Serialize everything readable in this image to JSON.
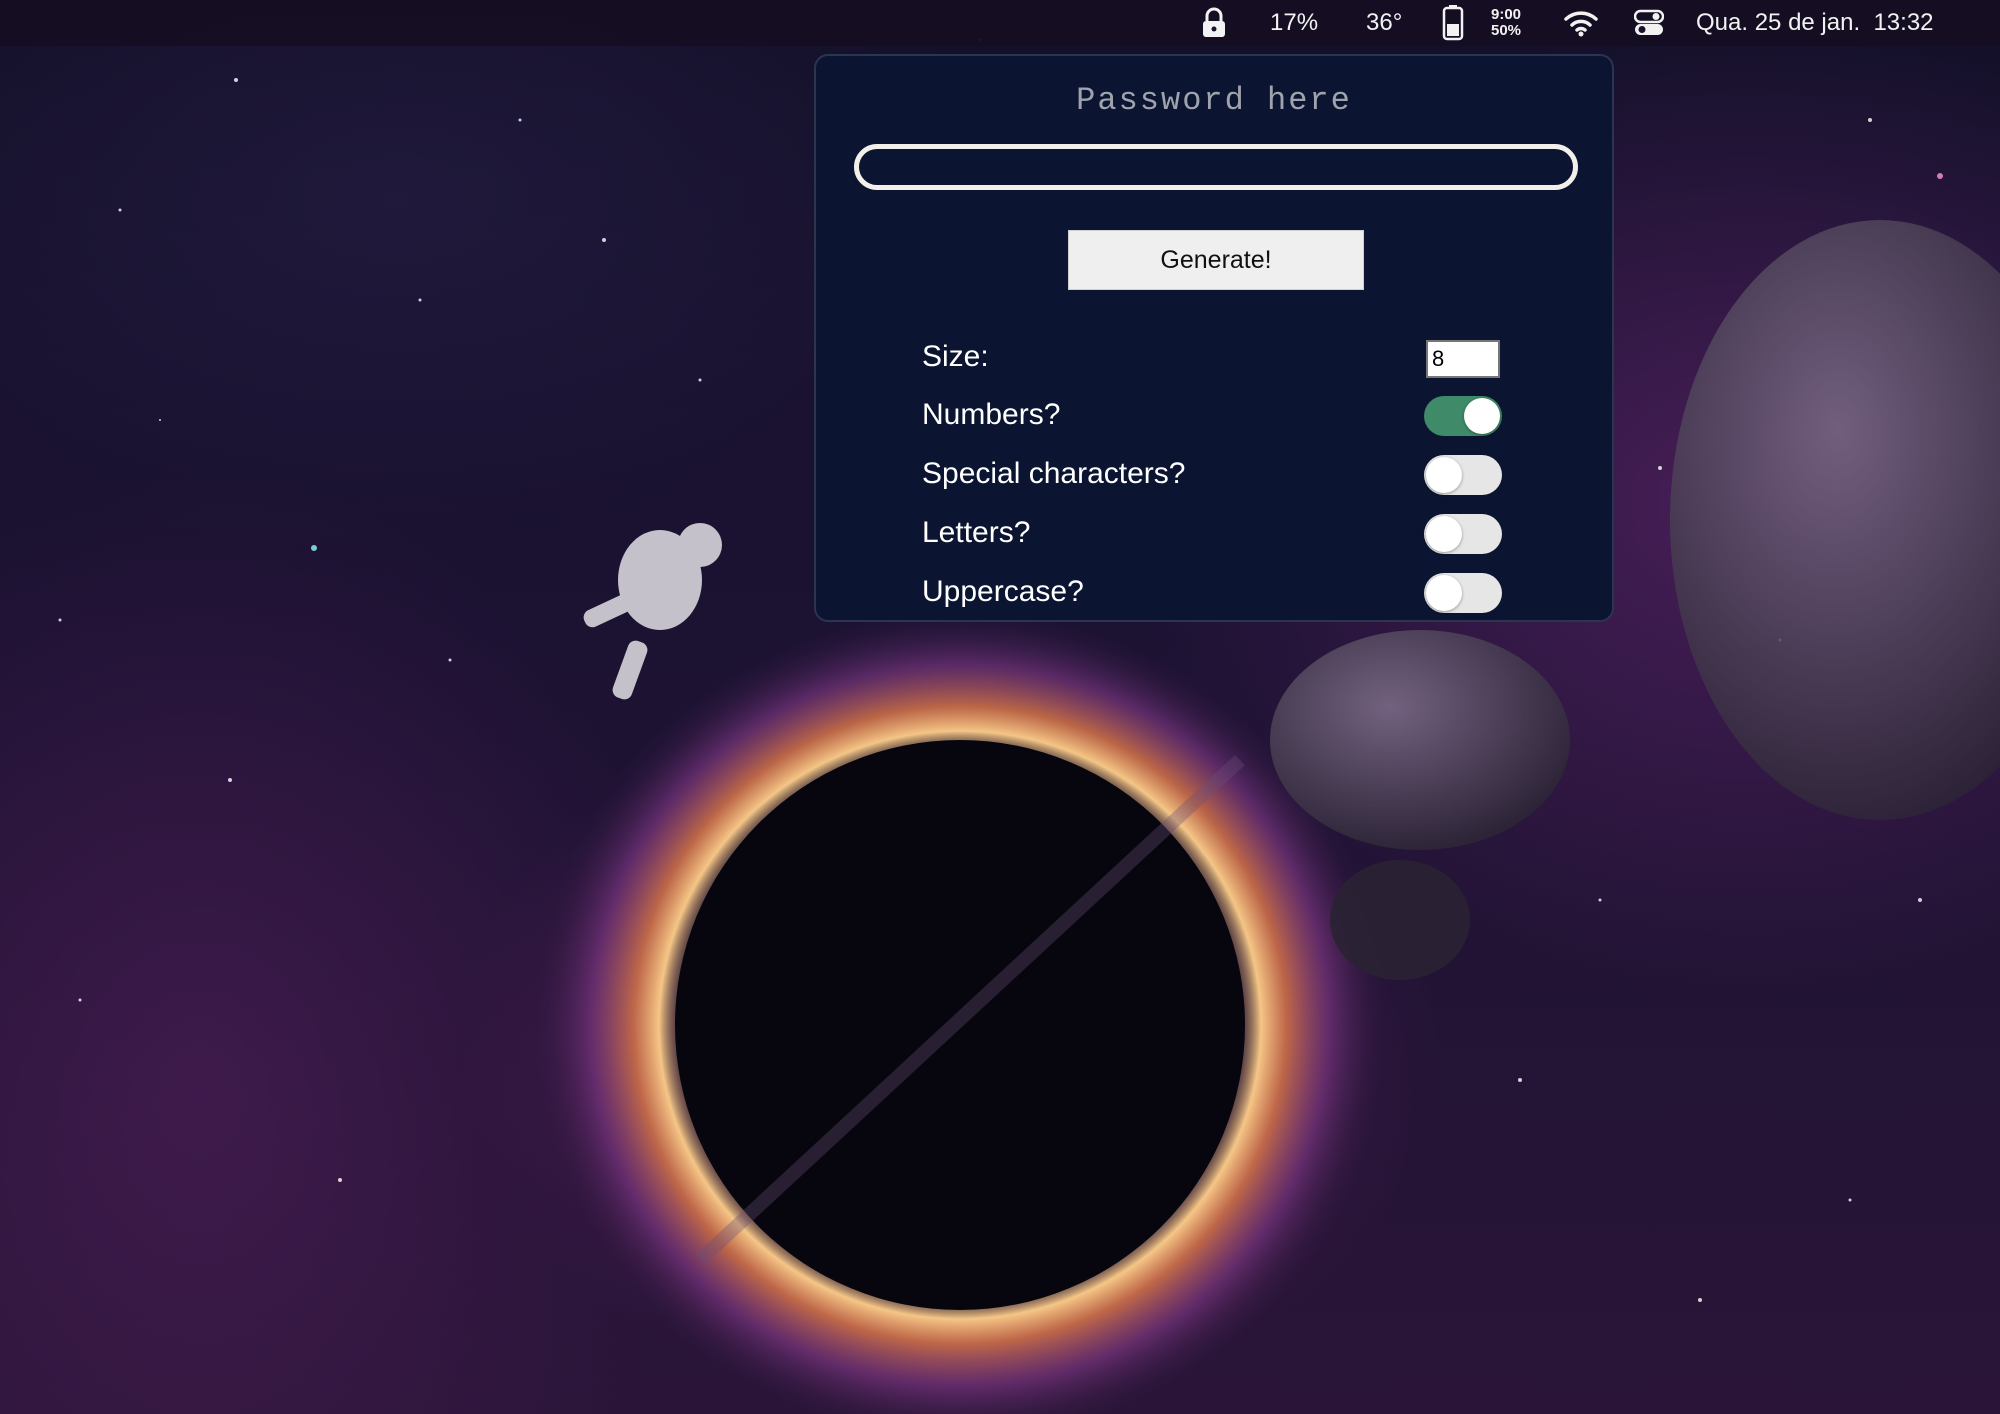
{
  "menubar": {
    "battery_percent": "17%",
    "temperature": "36°",
    "usage_line1": "9:00",
    "usage_line2": "50%",
    "datetime": "Qua. 25 de jan.  13:32"
  },
  "generator": {
    "title_placeholder": "Password here",
    "password_value": "",
    "generate_label": "Generate!",
    "size_label": "Size:",
    "size_value": "8",
    "options": [
      {
        "label": "Numbers?",
        "enabled": true
      },
      {
        "label": "Special characters?",
        "enabled": false
      },
      {
        "label": "Letters?",
        "enabled": false
      },
      {
        "label": "Uppercase?",
        "enabled": false
      }
    ]
  },
  "colors": {
    "popup_background": "#0b1430",
    "toggle_on": "#3f8a68",
    "toggle_off": "#e6e6e6"
  }
}
